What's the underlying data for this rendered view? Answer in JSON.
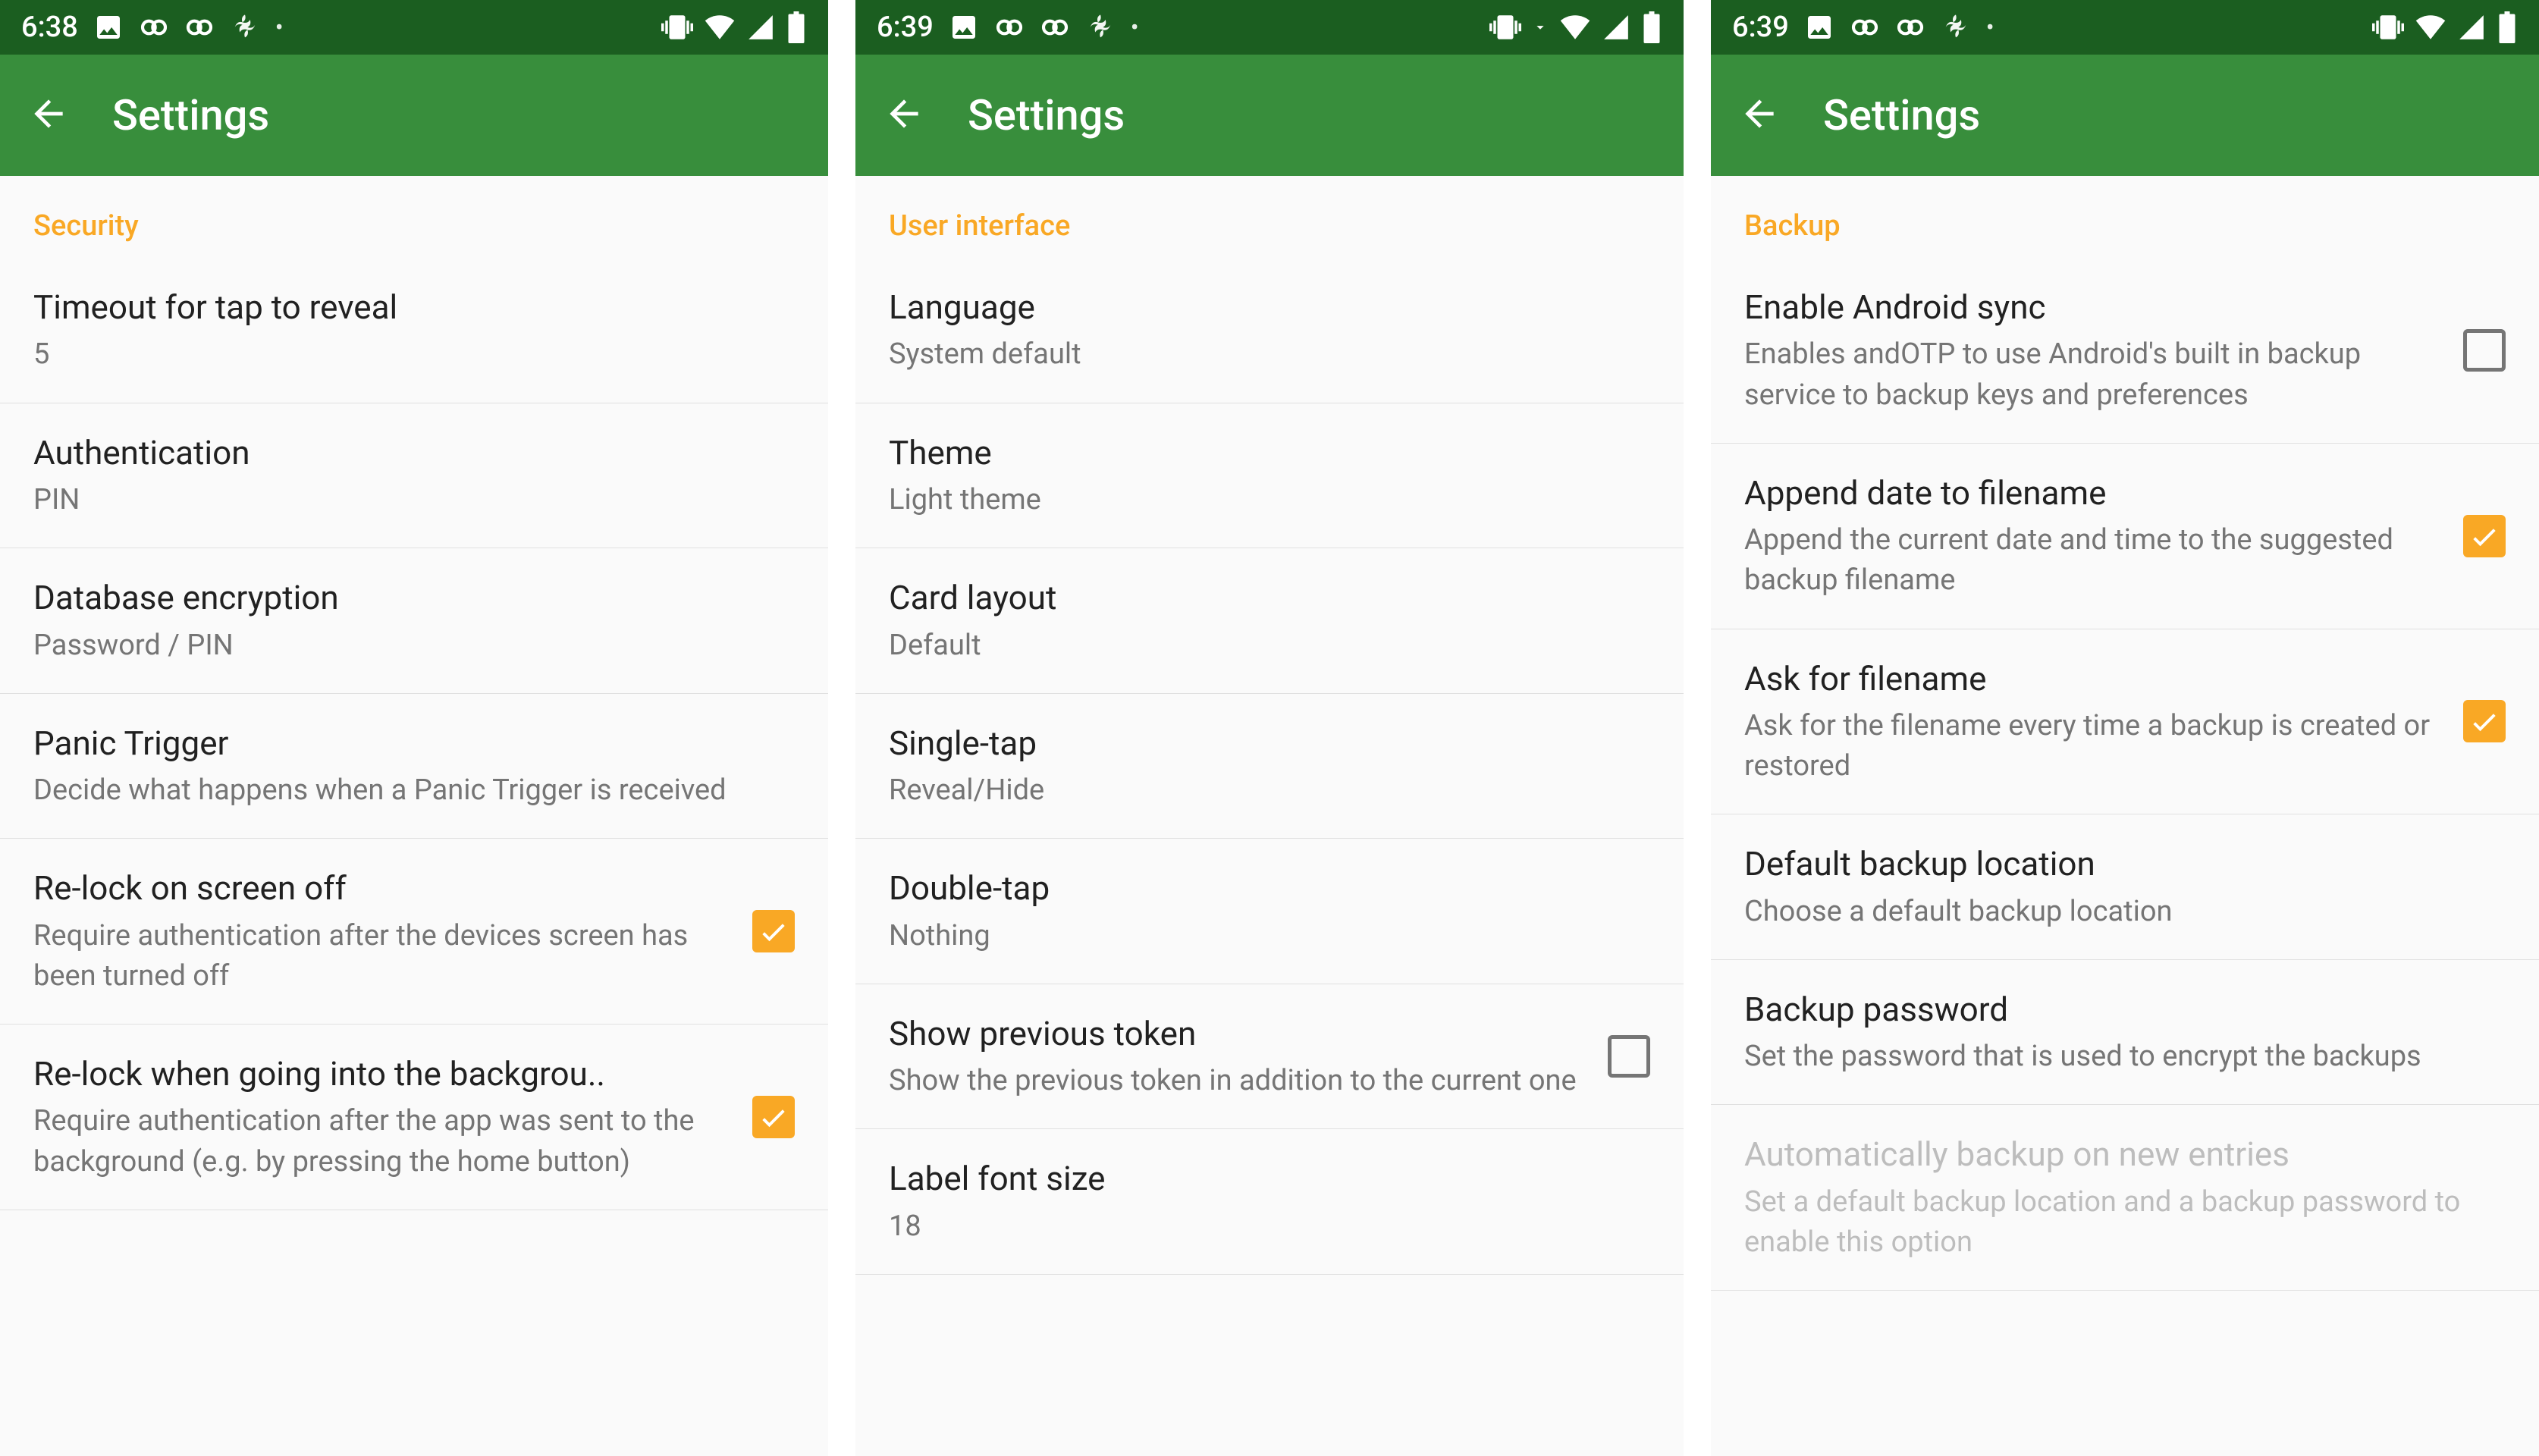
{
  "screens": [
    {
      "status": {
        "time": "6:38"
      },
      "appbar": {
        "title": "Settings"
      },
      "section": "Security",
      "prefs": [
        {
          "title": "Timeout for tap to reveal",
          "summary": "5",
          "checkbox": null,
          "disabled": false,
          "wrap": false
        },
        {
          "title": "Authentication",
          "summary": "PIN",
          "checkbox": null,
          "disabled": false,
          "wrap": false
        },
        {
          "title": "Database encryption",
          "summary": "Password / PIN",
          "checkbox": null,
          "disabled": false,
          "wrap": false
        },
        {
          "title": "Panic Trigger",
          "summary": "Decide what happens when a Panic Trigger is received",
          "checkbox": null,
          "disabled": false,
          "wrap": false
        },
        {
          "title": "Re-lock on screen off",
          "summary": "Require authentication after the devices screen has been turned off",
          "checkbox": true,
          "disabled": false,
          "wrap": false
        },
        {
          "title": "Re-lock when going into the backgrou..",
          "summary": "Require authentication after the app was sent to the background (e.g. by pressing the home button)",
          "checkbox": true,
          "disabled": false,
          "wrap": false
        }
      ]
    },
    {
      "status": {
        "time": "6:39"
      },
      "appbar": {
        "title": "Settings"
      },
      "section": "User interface",
      "prefs": [
        {
          "title": "Language",
          "summary": "System default",
          "checkbox": null,
          "disabled": false,
          "wrap": false
        },
        {
          "title": "Theme",
          "summary": "Light theme",
          "checkbox": null,
          "disabled": false,
          "wrap": false
        },
        {
          "title": "Card layout",
          "summary": "Default",
          "checkbox": null,
          "disabled": false,
          "wrap": false
        },
        {
          "title": "Single-tap",
          "summary": "Reveal/Hide",
          "checkbox": null,
          "disabled": false,
          "wrap": false
        },
        {
          "title": "Double-tap",
          "summary": "Nothing",
          "checkbox": null,
          "disabled": false,
          "wrap": false
        },
        {
          "title": "Show previous token",
          "summary": "Show the previous token in addition to the current one",
          "checkbox": false,
          "disabled": false,
          "wrap": false
        },
        {
          "title": "Label font size",
          "summary": "18",
          "checkbox": null,
          "disabled": false,
          "wrap": false
        }
      ]
    },
    {
      "status": {
        "time": "6:39"
      },
      "appbar": {
        "title": "Settings"
      },
      "section": "Backup",
      "prefs": [
        {
          "title": "Enable Android sync",
          "summary": "Enables andOTP to use Android's built in backup service to backup keys and preferences",
          "checkbox": false,
          "disabled": false,
          "wrap": false
        },
        {
          "title": "Append date to filename",
          "summary": "Append the current date and time to the suggested backup filename",
          "checkbox": true,
          "disabled": false,
          "wrap": false
        },
        {
          "title": "Ask for filename",
          "summary": "Ask for the filename every time a backup is created or restored",
          "checkbox": true,
          "disabled": false,
          "wrap": false
        },
        {
          "title": "Default backup location",
          "summary": "Choose a default backup location",
          "checkbox": null,
          "disabled": false,
          "wrap": false
        },
        {
          "title": "Backup password",
          "summary": "Set the password that is used to encrypt the backups",
          "checkbox": null,
          "disabled": false,
          "wrap": false
        },
        {
          "title": "Automatically backup on new entries",
          "summary": "Set a default backup location and a backup password to enable this option",
          "checkbox": null,
          "disabled": true,
          "wrap": true
        }
      ]
    }
  ]
}
